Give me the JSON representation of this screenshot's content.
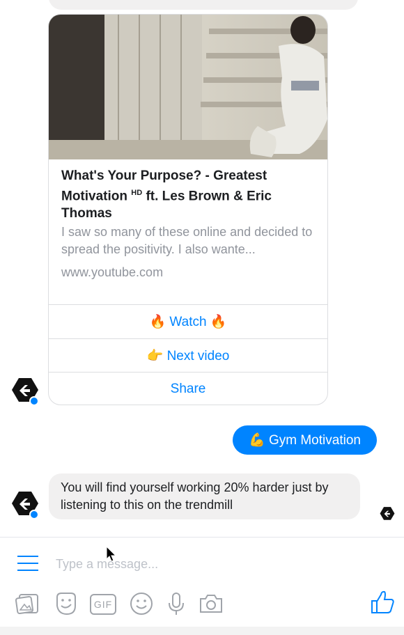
{
  "card": {
    "title": "What's Your Purpose? - Greatest Motivation",
    "title_hd": "HD",
    "title_rest": "ft. Les Brown & Eric Thomas",
    "subtitle": "I saw so many of these online and decided to spread the positivity. I also wante...",
    "url": "www.youtube.com",
    "buttons": [
      "🔥 Watch 🔥",
      "👉 Next video",
      "Share"
    ]
  },
  "sent_message": "💪 Gym Motivation",
  "received_message": "You will find yourself working 20% harder just by listening to this on the trendmill",
  "composer": {
    "placeholder": "Type a message...",
    "gif_label": "GIF"
  },
  "colors": {
    "accent": "#0084ff",
    "bubble_gray": "#f1f0f0",
    "icon_gray": "#a0a4aa"
  },
  "icons": [
    "menu-icon",
    "photo-icon",
    "sticker-icon",
    "gif-icon",
    "emoji-icon",
    "microphone-icon",
    "camera-icon",
    "thumbs-up-icon"
  ]
}
